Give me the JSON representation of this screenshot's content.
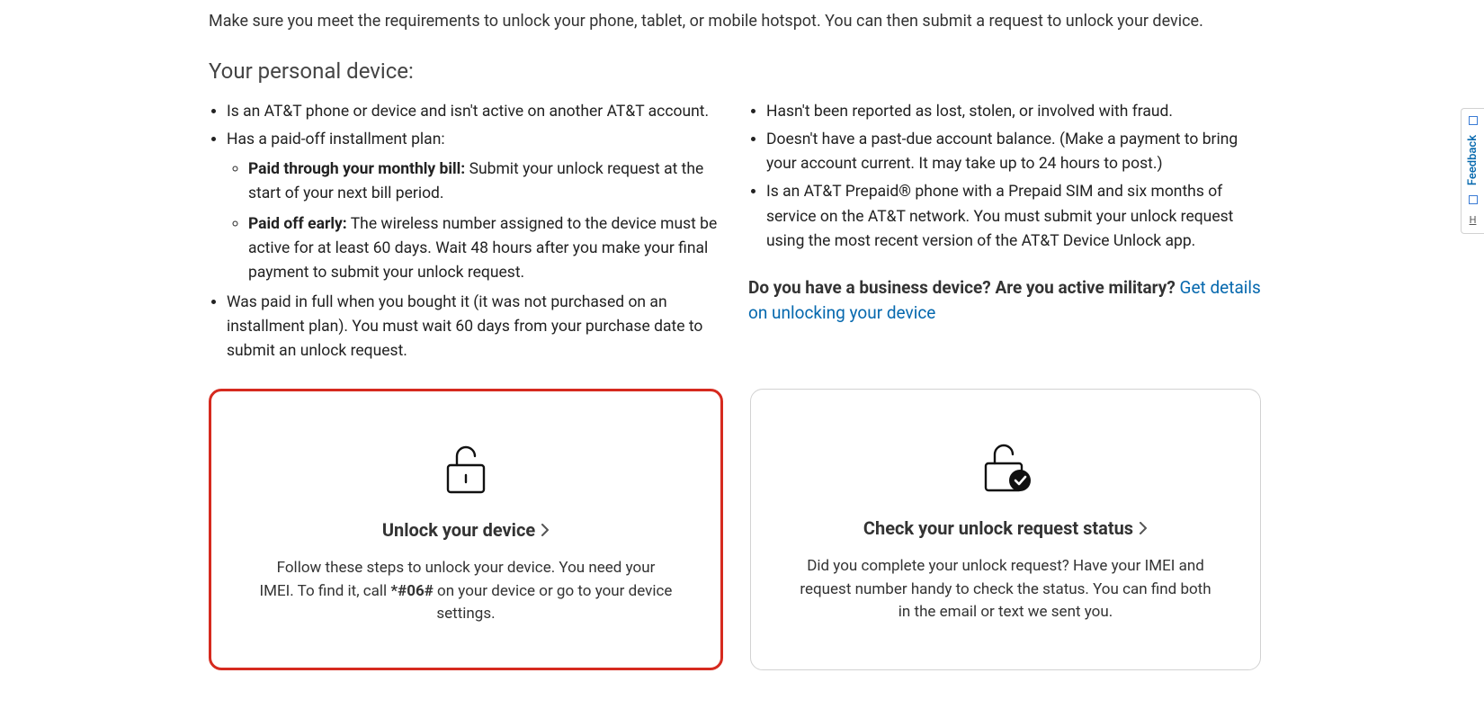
{
  "intro": "Make sure you meet the requirements to unlock your phone, tablet, or mobile hotspot. You can then submit a request to unlock your device.",
  "section_title": "Your personal device:",
  "left_list": {
    "i1": "Is an AT&T phone or device and isn't active on another AT&T account.",
    "i2": "Has a paid-off installment plan:",
    "i2a_bold": "Paid through your monthly bill:",
    "i2a_rest": " Submit your unlock request at the start of your next bill period.",
    "i2b_bold": "Paid off early:",
    "i2b_rest": " The wireless number assigned to the device must be active for at least 60 days. Wait 48 hours after you make your final payment to submit your unlock request.",
    "i3": "Was paid in full when you bought it (it was not purchased on an installment plan). You must wait 60 days from your purchase date to submit an unlock request."
  },
  "right_list": {
    "i1": "Hasn't been reported as lost, stolen, or involved with fraud.",
    "i2": "Doesn't have a past-due account balance. (Make a payment to bring your account current. It may take up to 24 hours to post.)",
    "i3": "Is an AT&T Prepaid® phone with a Prepaid SIM and six months of service on the AT&T network. You must submit your unlock request using the most recent version of the AT&T Device Unlock app."
  },
  "biz": {
    "question": "Do you have a business device? Are you active military? ",
    "link": "Get details on unlocking your device"
  },
  "cards": {
    "unlock": {
      "title": "Unlock your device",
      "desc_pre": "Follow these steps to unlock your device. You need your IMEI. To find it, call ",
      "desc_code": "*#06#",
      "desc_post": " on your device or go to your device settings."
    },
    "status": {
      "title": "Check your unlock request status",
      "desc": "Did you complete your unlock request? Have your IMEI and request number handy to check the status. You can find both in the email or text we sent you."
    }
  },
  "feedback": {
    "label": "Feedback",
    "h": "H"
  }
}
